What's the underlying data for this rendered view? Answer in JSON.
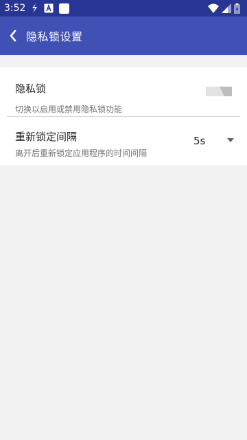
{
  "status_bar": {
    "time": "3:52",
    "left_icons": [
      "notification-s-icon",
      "notification-a-icon",
      "notification-square-icon"
    ],
    "right_icons": [
      "wifi-icon",
      "signal-icon",
      "battery-icon"
    ]
  },
  "toolbar": {
    "title": "隐私锁设置",
    "back_icon": "chevron-left-icon"
  },
  "settings": {
    "privacy_lock": {
      "title": "隐私锁",
      "subtitle": "切换以启用或禁用隐私锁功能",
      "enabled": false
    },
    "relock_interval": {
      "title": "重新锁定间隔",
      "subtitle": "离开后重新锁定应用程序的时间间隔",
      "value": "5s"
    }
  },
  "colors": {
    "status_bar": "#283593",
    "toolbar": "#3f51b5",
    "background": "#f2f2f2"
  }
}
